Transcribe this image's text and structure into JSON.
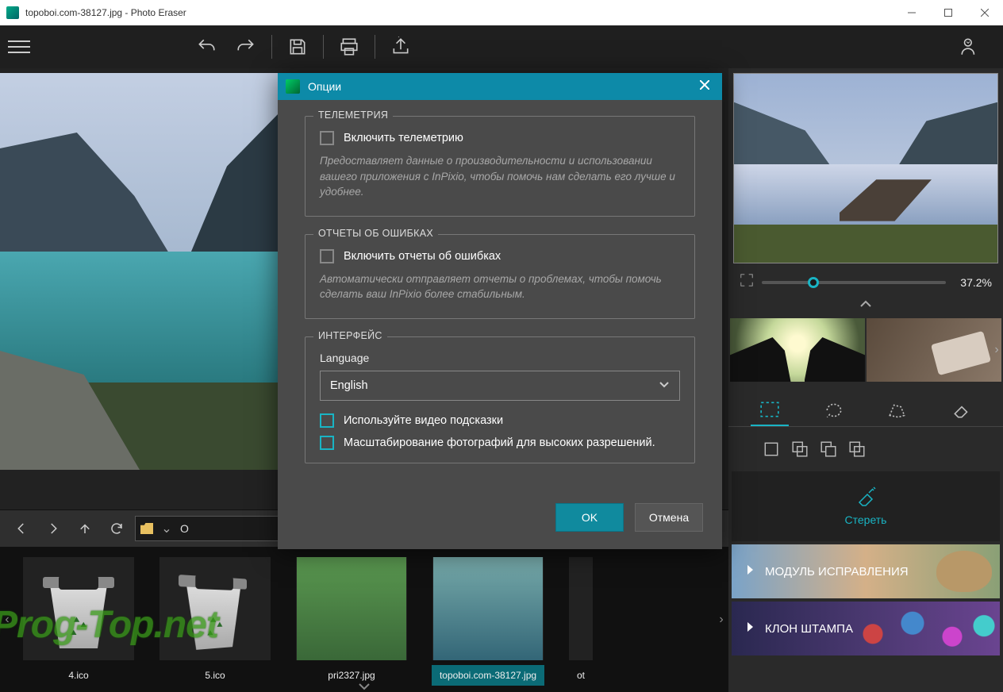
{
  "titlebar": {
    "text": "topoboi.com-38127.jpg - Photo Eraser"
  },
  "dialog": {
    "title": "Опции",
    "telemetry": {
      "legend": "ТЕЛЕМЕТРИЯ",
      "checkbox": "Включить телеметрию",
      "desc": "Предоставляет данные о производительности и использовании вашего приложения с InPixio, чтобы помочь нам сделать его лучше и удобнее."
    },
    "errors": {
      "legend": "ОТЧЕТЫ ОБ ОШИБКАХ",
      "checkbox": "Включить отчеты об ошибках",
      "desc": "Автоматически отправляет отчеты о проблемах, чтобы помочь сделать ваш InPixio более стабильным."
    },
    "interface": {
      "legend": "ИНТЕРФЕЙС",
      "lang_label": "Language",
      "lang_value": "English",
      "video_hints": "Используйте видео подсказки",
      "scaling": "Масштабирование фотографий для высоких разрешений."
    },
    "ok": "OK",
    "cancel": "Отмена"
  },
  "zoom": {
    "percent": "37.2%"
  },
  "rightpanel": {
    "erase": "Стереть",
    "module_correction": "МОДУЛЬ ИСПРАВЛЕНИЯ",
    "module_stamp": "КЛОН ШТАМПА"
  },
  "browser": {
    "path_visible": "O",
    "thumbs": [
      {
        "label": "4.ico"
      },
      {
        "label": "5.ico"
      },
      {
        "label": "pri2327.jpg"
      },
      {
        "label": "topoboi.com-38127.jpg"
      },
      {
        "label": "ot"
      }
    ]
  },
  "watermark": "Prog-Top.net"
}
